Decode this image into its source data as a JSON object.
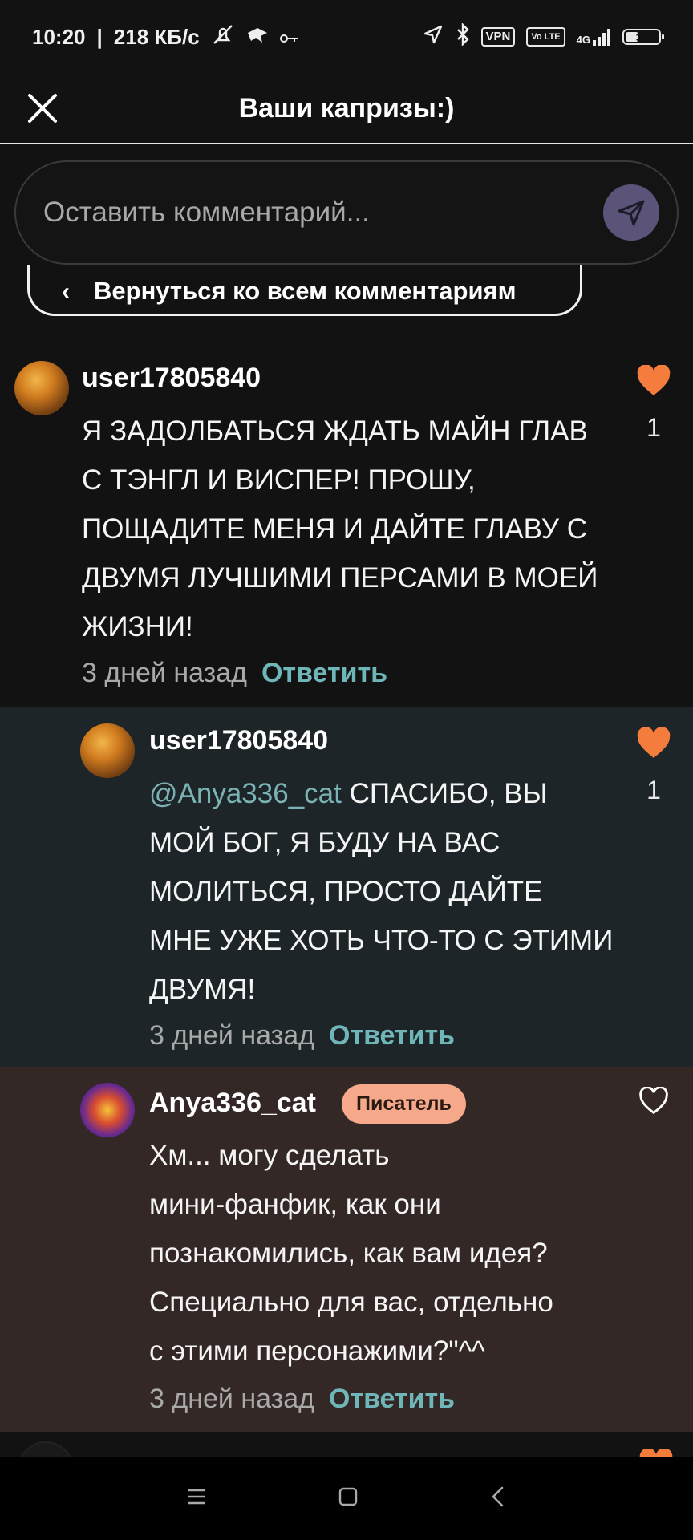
{
  "status_bar": {
    "time": "10:20",
    "speed": "218 КБ/с",
    "vpn": "VPN",
    "volte": "Vo LTE",
    "network": "4G",
    "battery": "36"
  },
  "header": {
    "title": "Ваши капризы:)"
  },
  "comment_input": {
    "placeholder": "Оставить комментарий..."
  },
  "back_button": {
    "label": "Вернуться ко всем комментариям"
  },
  "comments": [
    {
      "username": "user17805840",
      "lines": [
        "Я ЗАДОЛБАТЬСЯ ЖДАТЬ МАЙН ГЛАВ",
        "С ТЭНГЛ И ВИСПЕР! ПРОШУ,",
        "ПОЩАДИТЕ МЕНЯ И ДАЙТЕ ГЛАВУ С",
        "ДВУМЯ ЛУЧШИМИ ПЕРСАМИ В МОЕЙ",
        "ЖИЗНИ!"
      ],
      "time": "3 дней назад",
      "reply": "Ответить",
      "likes": "1"
    },
    {
      "username": "user17805840",
      "mention": "@Anya336_cat",
      "lines": [
        "СПАСИБО, ВЫ",
        "МОЙ БОГ, Я БУДУ НА ВАС",
        "МОЛИТЬСЯ, ПРОСТО ДАЙТЕ",
        "МНЕ УЖЕ ХОТЬ ЧТО-ТО С ЭТИМИ",
        "ДВУМЯ!"
      ],
      "time": "3 дней назад",
      "reply": "Ответить",
      "likes": "1"
    },
    {
      "username": "Anya336_cat",
      "badge": "Писатель",
      "lines": [
        "Хм... могу сделать",
        "мини-фанфик, как они",
        "познакомились, как вам идея?",
        "Специально  для вас, отдельно",
        "с этими персонажими?\"^^"
      ],
      "time": "3 дней назад",
      "reply": "Ответить"
    }
  ],
  "colors": {
    "heart": "#f47c3c",
    "reply": "#6fb6b8",
    "badge": "#f5a98a",
    "send_button": "#5b5478"
  }
}
